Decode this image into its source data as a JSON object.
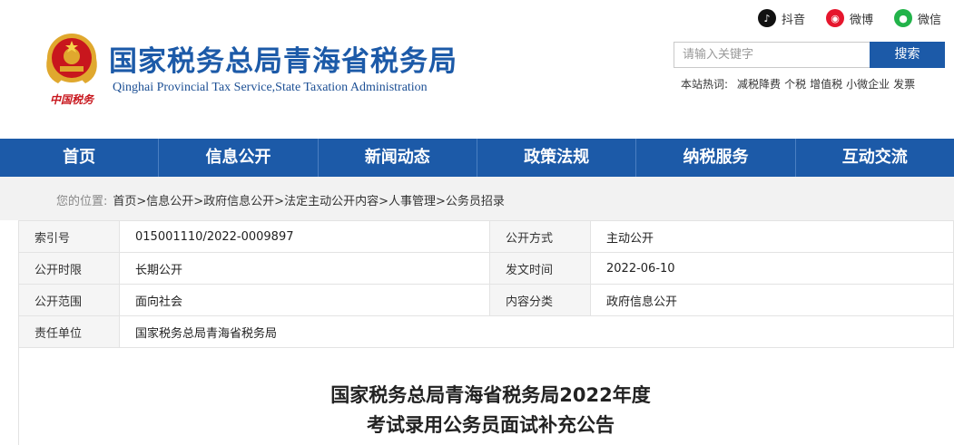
{
  "header": {
    "title": "国家税务总局青海省税务局",
    "subtitle": "Qinghai Provincial Tax Service,State Taxation Administration",
    "emblem_caption": "中国税务",
    "social": [
      {
        "label": "抖音",
        "icon": "douyin-icon"
      },
      {
        "label": "微博",
        "icon": "weibo-icon"
      },
      {
        "label": "微信",
        "icon": "wechat-icon"
      }
    ],
    "search": {
      "placeholder": "请输入关键字",
      "button": "搜索"
    },
    "hotwords": {
      "label": "本站热词:",
      "items": [
        "减税降费",
        "个税",
        "增值税",
        "小微企业",
        "发票"
      ]
    }
  },
  "nav": [
    "首页",
    "信息公开",
    "新闻动态",
    "政策法规",
    "纳税服务",
    "互动交流"
  ],
  "breadcrumb": {
    "prefix": "您的位置:",
    "path": "首页>信息公开>政府信息公开>法定主动公开内容>人事管理>公务员招录"
  },
  "info": {
    "index_label": "索引号",
    "index_value": "015001110/2022-0009897",
    "method_label": "公开方式",
    "method_value": "主动公开",
    "period_label": "公开时限",
    "period_value": "长期公开",
    "date_label": "发文时间",
    "date_value": "2022-06-10",
    "scope_label": "公开范围",
    "scope_value": "面向社会",
    "category_label": "内容分类",
    "category_value": "政府信息公开",
    "unit_label": "责任单位",
    "unit_value": "国家税务总局青海省税务局"
  },
  "article": {
    "title_line1": "国家税务总局青海省税务局2022年度",
    "title_line2": "考试录用公务员面试补充公告"
  },
  "colors": {
    "brand_blue": "#1c5aa8",
    "emblem_red": "#c8161d",
    "emblem_gold": "#e0a82e"
  }
}
